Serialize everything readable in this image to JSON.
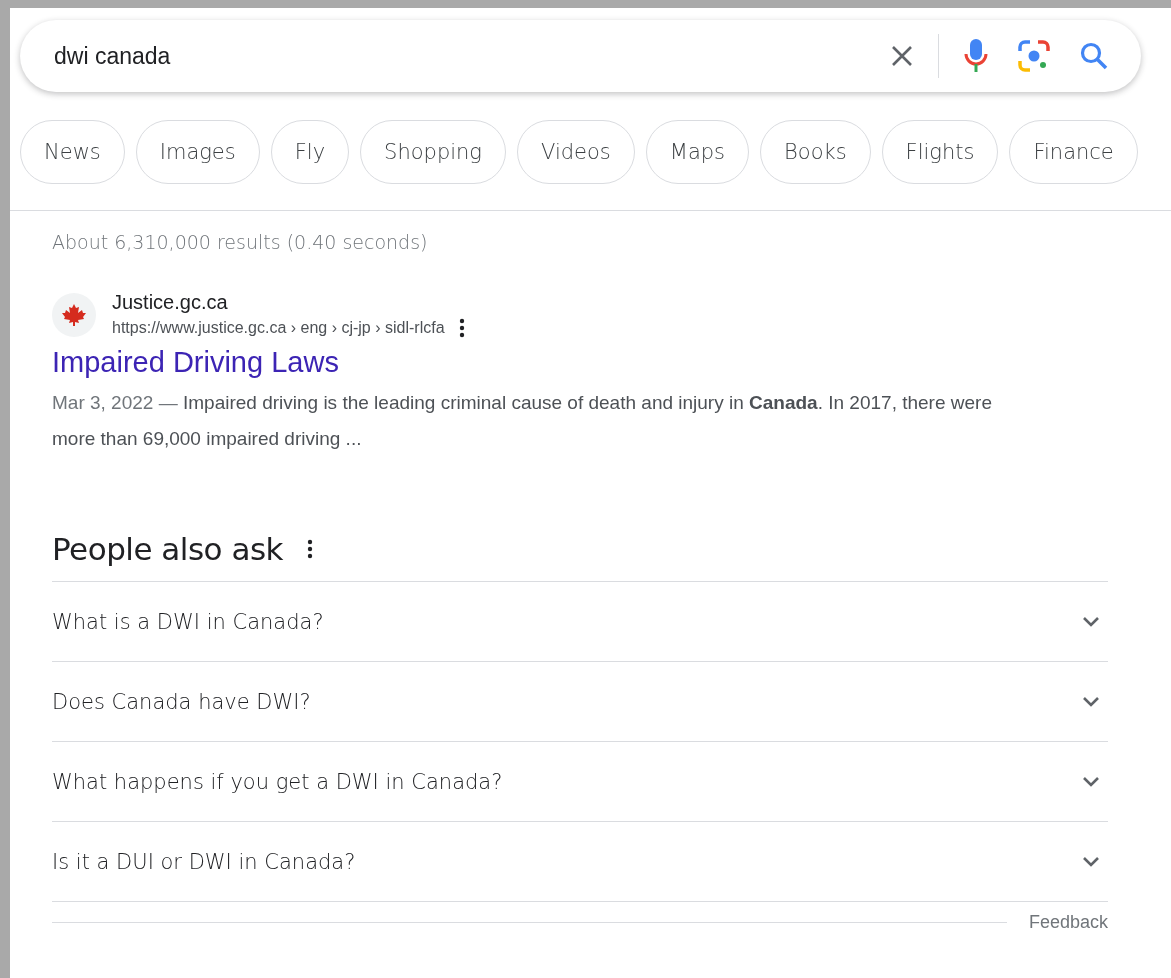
{
  "search": {
    "value": "dwi canada"
  },
  "chips": [
    "News",
    "Images",
    "Fly",
    "Shopping",
    "Videos",
    "Maps",
    "Books",
    "Flights",
    "Finance"
  ],
  "stats": "About 6,310,000 results (0.40 seconds)",
  "result": {
    "site": "Justice.gc.ca",
    "url": "https://www.justice.gc.ca › eng › cj-jp › sidl-rlcfa",
    "title": "Impaired Driving Laws",
    "date": "Mar 3, 2022 —",
    "snippet": "Impaired driving is the leading criminal cause of death and injury in **Canada**. In 2017, there were more than 69,000 impaired driving ..."
  },
  "people_also_ask": {
    "title": "People also ask",
    "questions": [
      {
        "text": "What is a DWI in Canada?",
        "expanded": false
      },
      {
        "text": "Does Canada have DWI?",
        "expanded": false
      },
      {
        "text": "What happens if you get a DWI in Canada?",
        "expanded": false
      },
      {
        "text": "Is it a DUI or DWI in Canada?",
        "expanded": false
      }
    ],
    "feedback": "Feedback"
  }
}
